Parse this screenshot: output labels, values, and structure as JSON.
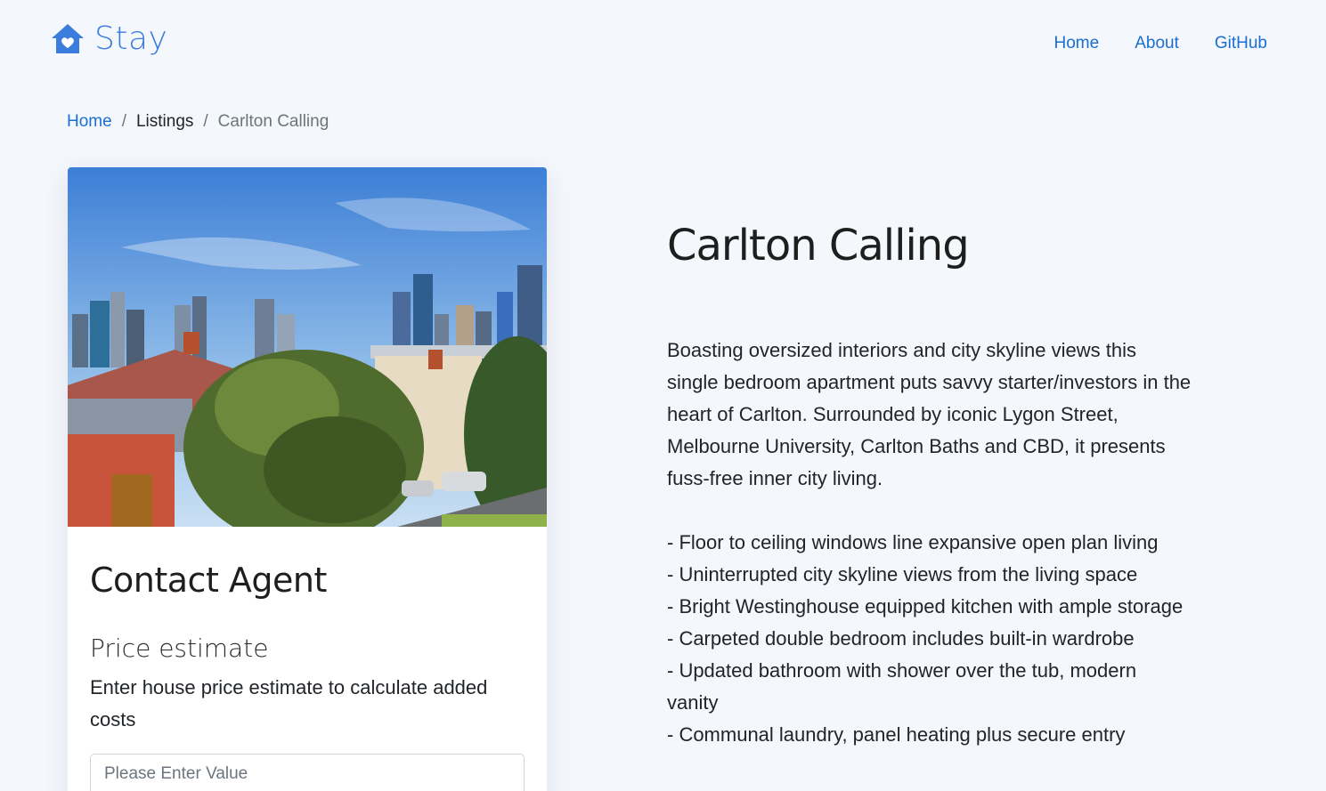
{
  "brand": {
    "name": "Stay",
    "icon": "house-heart-icon",
    "color": "#3b7ddd"
  },
  "nav": {
    "links": [
      "Home",
      "About",
      "GitHub"
    ]
  },
  "breadcrumb": {
    "home": "Home",
    "listings": "Listings",
    "current": "Carlton Calling"
  },
  "listing": {
    "title": "Carlton Calling",
    "description": "Boasting oversized interiors and city skyline views this single bedroom apartment puts savvy starter/investors in the heart of Carlton. Surrounded by iconic Lygon Street, Melbourne University, Carlton Baths and CBD, it presents fuss-free inner city living.",
    "features": [
      "- Floor to ceiling windows line expansive open plan living",
      "- Uninterrupted city skyline views from the living space",
      "- Bright Westinghouse equipped kitchen with ample storage",
      "- Carpeted double bedroom includes built-in wardrobe",
      "- Updated bathroom with shower over the tub, modern vanity",
      "- Communal laundry, panel heating plus secure entry"
    ]
  },
  "contact": {
    "title": "Contact Agent",
    "price_title": "Price estimate",
    "price_desc": "Enter house price estimate to calculate added costs",
    "input_placeholder": "Please Enter Value"
  },
  "colors": {
    "link": "#1a6fd1",
    "background": "#f4f7fc"
  }
}
